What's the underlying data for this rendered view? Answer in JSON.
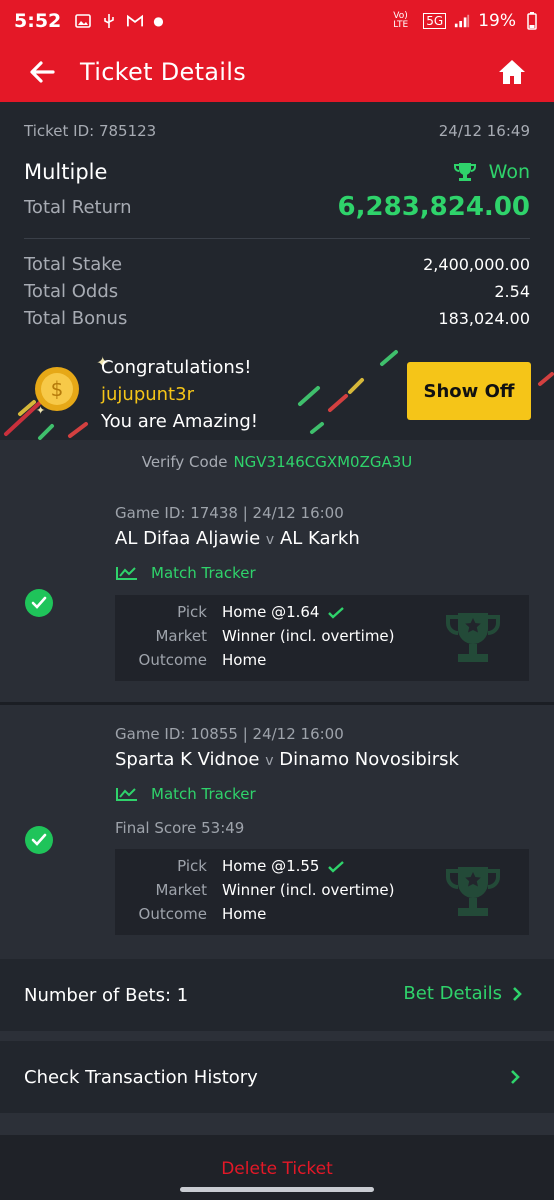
{
  "status": {
    "time": "5:52",
    "network_label": "Vo) LTE",
    "network_type": "5G",
    "battery": "19%"
  },
  "appbar": {
    "title": "Ticket Details"
  },
  "ticket": {
    "id_label": "Ticket ID: 785123",
    "datetime": "24/12 16:49",
    "type": "Multiple",
    "status": "Won",
    "total_return_label": "Total Return",
    "total_return_value": "6,283,824.00",
    "total_stake_label": "Total Stake",
    "total_stake_value": "2,400,000.00",
    "total_odds_label": "Total Odds",
    "total_odds_value": "2.54",
    "total_bonus_label": "Total Bonus",
    "total_bonus_value": "183,024.00"
  },
  "congrats": {
    "title": "Congratulations!",
    "username": "jujupunt3r",
    "message": "You are Amazing!",
    "show_off_label": "Show Off"
  },
  "verify": {
    "label": "Verify Code",
    "code": "NGV3146CGXM0ZGA3U"
  },
  "games": [
    {
      "game_info": "Game ID: 17438 | 24/12 16:00",
      "home": "AL Difaa Aljawie",
      "vs": "v",
      "away": "AL Karkh",
      "tracker_label": "Match Tracker",
      "final_score": "",
      "pick_label": "Pick",
      "pick_value": "Home @1.64",
      "market_label": "Market",
      "market_value": "Winner (incl. overtime)",
      "outcome_label": "Outcome",
      "outcome_value": "Home"
    },
    {
      "game_info": "Game ID: 10855 | 24/12 16:00",
      "home": "Sparta K Vidnoe",
      "vs": "v",
      "away": "Dinamo Novosibirsk",
      "tracker_label": "Match Tracker",
      "final_score": "Final Score  53:49",
      "pick_label": "Pick",
      "pick_value": "Home @1.55",
      "market_label": "Market",
      "market_value": "Winner (incl. overtime)",
      "outcome_label": "Outcome",
      "outcome_value": "Home"
    }
  ],
  "footer": {
    "bets_count_label": "Number of Bets: 1",
    "bet_details_label": "Bet Details",
    "transaction_history_label": "Check Transaction History",
    "delete_label": "Delete Ticket"
  },
  "colors": {
    "brand_red": "#e41827",
    "win_green": "#2fd36b",
    "accent_yellow": "#f5c518"
  }
}
